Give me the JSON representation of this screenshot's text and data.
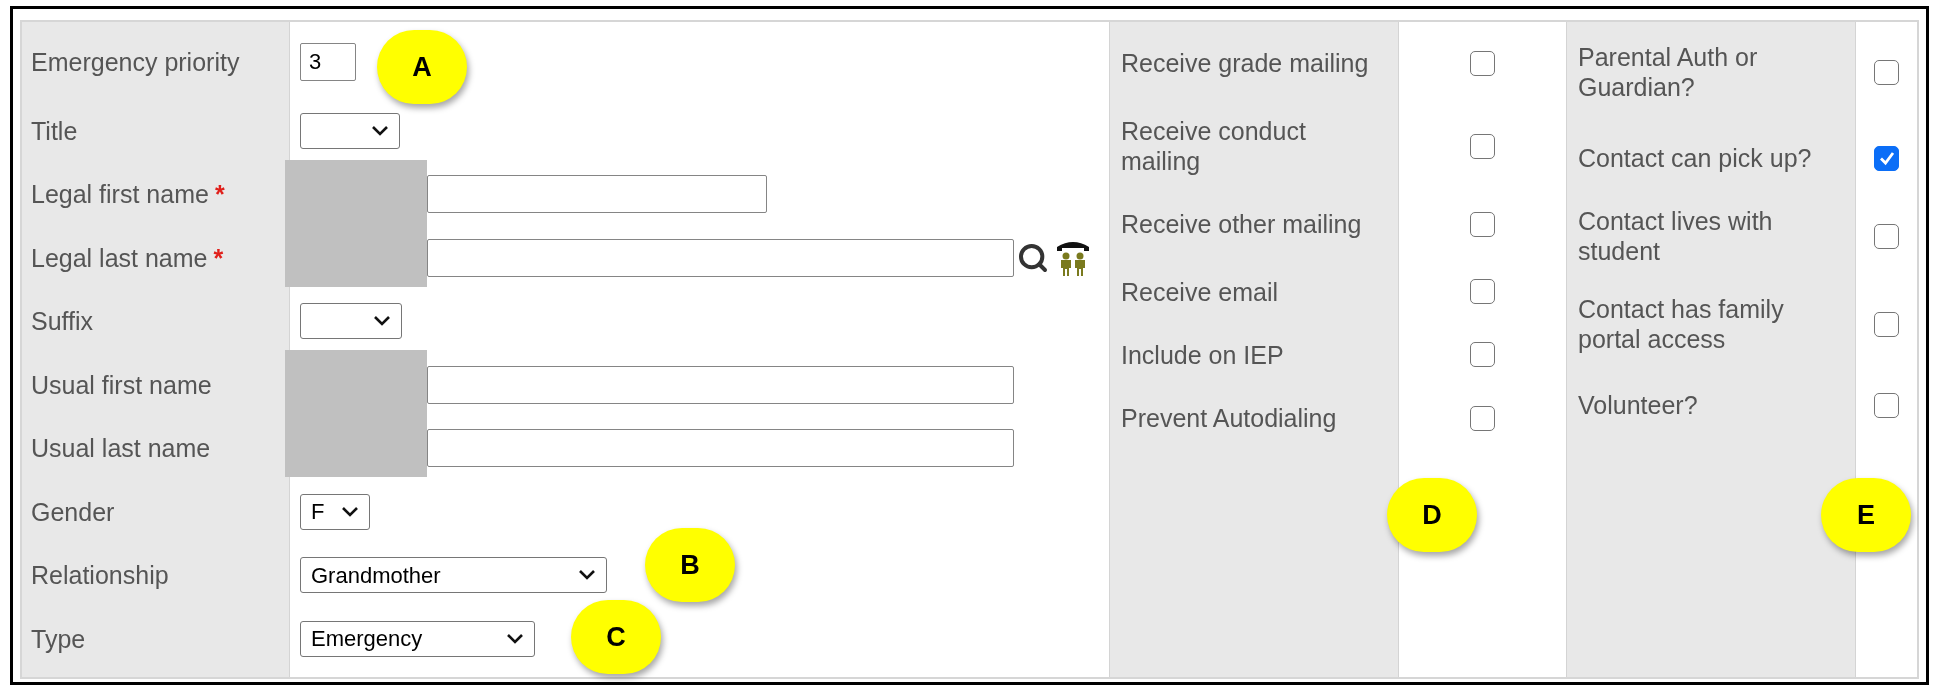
{
  "left_fields": [
    {
      "label": "Emergency priority",
      "kind": "number",
      "value": "3"
    },
    {
      "label": "Title",
      "kind": "select"
    },
    {
      "label": "Legal first name",
      "required_mark": "*",
      "kind": "text",
      "redacted": true
    },
    {
      "label": "Legal last name",
      "required_mark": "*",
      "kind": "text",
      "redacted": true,
      "lookup": true
    },
    {
      "label": "Suffix",
      "kind": "select"
    },
    {
      "label": "Usual first name",
      "kind": "text",
      "redacted": true
    },
    {
      "label": "Usual last name",
      "kind": "text",
      "redacted": true
    },
    {
      "label": "Gender",
      "kind": "select",
      "value": "F"
    },
    {
      "label": "Relationship",
      "kind": "select",
      "value": "Grandmother"
    },
    {
      "label": "Type",
      "kind": "select",
      "value": "Emergency"
    }
  ],
  "mailing_options": [
    {
      "label": "Receive grade mailing",
      "checked": false
    },
    {
      "label": "Receive conduct mailing",
      "checked": false
    },
    {
      "label": "Receive other mailing",
      "checked": false
    },
    {
      "label": "Receive email",
      "checked": false
    },
    {
      "label": "Include on IEP",
      "checked": false
    },
    {
      "label": "Prevent Autodialing",
      "checked": false
    }
  ],
  "contact_options": [
    {
      "label": "Parental Auth or Guardian?",
      "checked": false
    },
    {
      "label": "Contact can pick up?",
      "checked": true
    },
    {
      "label": "Contact lives with student",
      "checked": false
    },
    {
      "label": "Contact has family portal access",
      "checked": false
    },
    {
      "label": "Volunteer?",
      "checked": false
    }
  ],
  "annotations": [
    "A",
    "B",
    "C",
    "D",
    "E"
  ]
}
